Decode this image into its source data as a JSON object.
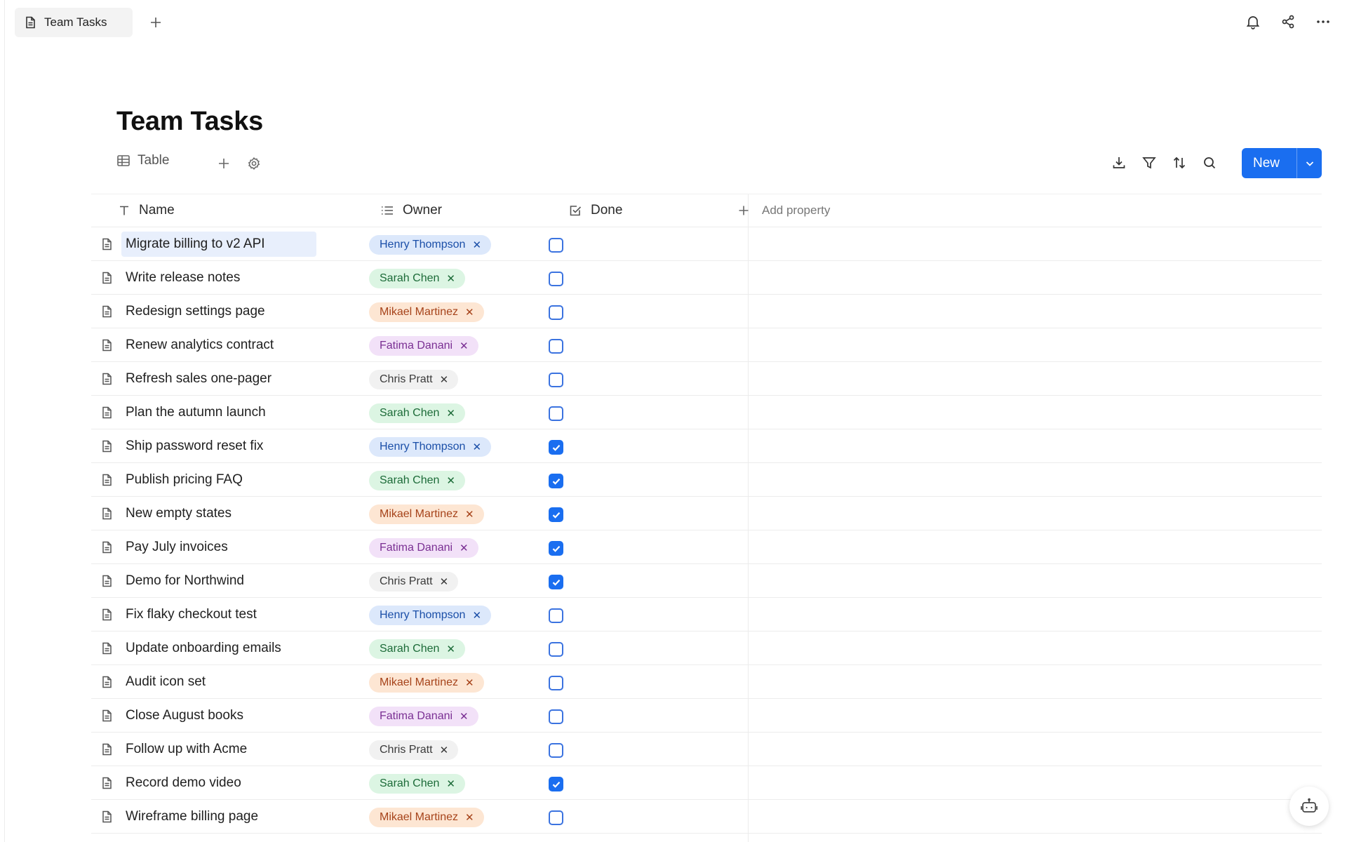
{
  "tab": {
    "title": "Team Tasks"
  },
  "page": {
    "title": "Team Tasks"
  },
  "view": {
    "label": "Table"
  },
  "new_button": {
    "label": "New"
  },
  "columns": {
    "name": "Name",
    "owner": "Owner",
    "done": "Done",
    "add_property": "Add property"
  },
  "owner_colors": {
    "Henry Thompson": {
      "bg": "#dce8fb",
      "fg": "#1b4fa8"
    },
    "Sarah Chen": {
      "bg": "#dcf5e3",
      "fg": "#1c6b38"
    },
    "Mikael Martinez": {
      "bg": "#fde6d3",
      "fg": "#a6431a"
    },
    "Fatima Danani": {
      "bg": "#f2e1f8",
      "fg": "#7a2f93"
    },
    "Chris Pratt": {
      "bg": "#f1f1f1",
      "fg": "#3a3a3a"
    }
  },
  "rows": [
    {
      "name": "Migrate billing to v2 API",
      "owner": "Henry Thompson",
      "done": false
    },
    {
      "name": "Write release notes",
      "owner": "Sarah Chen",
      "done": false
    },
    {
      "name": "Redesign settings page",
      "owner": "Mikael Martinez",
      "done": false
    },
    {
      "name": "Renew analytics contract",
      "owner": "Fatima Danani",
      "done": false
    },
    {
      "name": "Refresh sales one-pager",
      "owner": "Chris Pratt",
      "done": false
    },
    {
      "name": "Plan the autumn launch",
      "owner": "Sarah Chen",
      "done": false
    },
    {
      "name": "Ship password reset fix",
      "owner": "Henry Thompson",
      "done": true
    },
    {
      "name": "Publish pricing FAQ",
      "owner": "Sarah Chen",
      "done": true
    },
    {
      "name": "New empty states",
      "owner": "Mikael Martinez",
      "done": true
    },
    {
      "name": "Pay July invoices",
      "owner": "Fatima Danani",
      "done": true
    },
    {
      "name": "Demo for Northwind",
      "owner": "Chris Pratt",
      "done": true
    },
    {
      "name": "Fix flaky checkout test",
      "owner": "Henry Thompson",
      "done": false
    },
    {
      "name": "Update onboarding emails",
      "owner": "Sarah Chen",
      "done": false
    },
    {
      "name": "Audit icon set",
      "owner": "Mikael Martinez",
      "done": false
    },
    {
      "name": "Close August books",
      "owner": "Fatima Danani",
      "done": false
    },
    {
      "name": "Follow up with Acme",
      "owner": "Chris Pratt",
      "done": false
    },
    {
      "name": "Record demo video",
      "owner": "Sarah Chen",
      "done": true
    },
    {
      "name": "Wireframe billing page",
      "owner": "Mikael Martinez",
      "done": false
    }
  ]
}
